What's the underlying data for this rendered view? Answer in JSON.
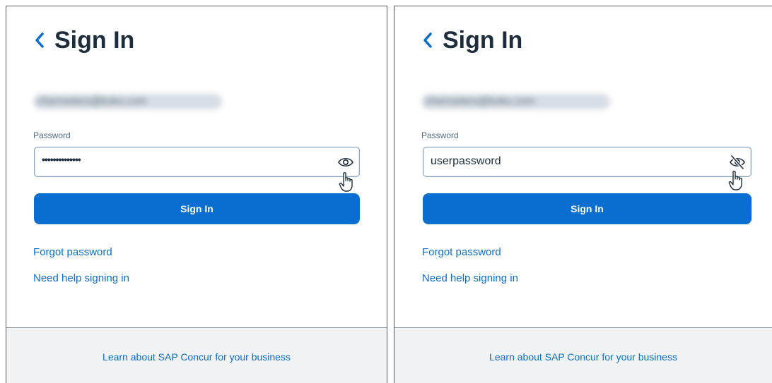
{
  "panels": {
    "left": {
      "title": "Sign In",
      "email_blurred": "chermeters@koko.com",
      "password_label": "Password",
      "password_value": "••••••••••••••",
      "password_visibility_icon": "eye-icon",
      "signin_label": "Sign In",
      "forgot_link": "Forgot password",
      "help_link": "Need help signing in",
      "footer_link": "Learn about SAP Concur for your business"
    },
    "right": {
      "title": "Sign In",
      "email_blurred": "chermeters@koko.com",
      "password_label": "Password",
      "password_value": "userpassword",
      "password_visibility_icon": "eye-slash-icon",
      "signin_label": "Sign In",
      "forgot_link": "Forgot password",
      "help_link": "Need help signing in",
      "footer_link": "Learn about SAP Concur for your business"
    }
  },
  "colors": {
    "primary": "#0a6ed1",
    "title_text": "#1d2d3e",
    "footer_bg": "#f0f2f4"
  }
}
